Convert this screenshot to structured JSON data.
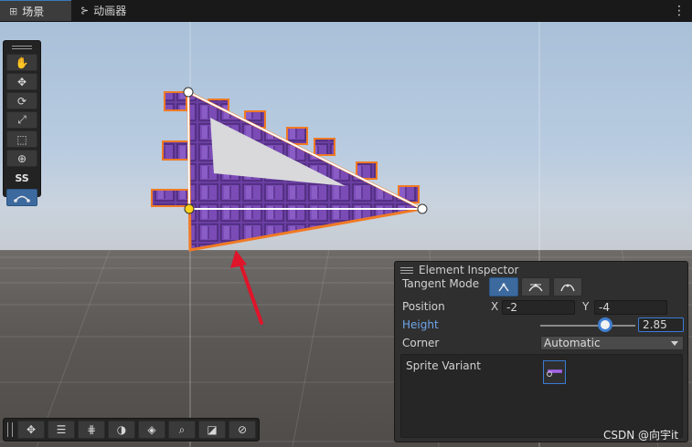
{
  "tabs": [
    {
      "icon": "grid-icon",
      "label": "场景",
      "active": true
    },
    {
      "icon": "animator-icon",
      "label": "动画器",
      "active": false
    }
  ],
  "tabbar_menu": "⋮",
  "left_toolbar": {
    "buttons": [
      {
        "name": "hand-tool",
        "icon": "hand-icon",
        "glyph": "✋"
      },
      {
        "name": "move-tool",
        "icon": "move-icon",
        "glyph": "✥"
      },
      {
        "name": "rotate-tool",
        "icon": "rotate-icon",
        "glyph": "⟳"
      },
      {
        "name": "scale-tool",
        "icon": "scale-icon",
        "glyph": "⤢"
      },
      {
        "name": "rect-tool",
        "icon": "rect-icon",
        "glyph": "⬚"
      },
      {
        "name": "transform-tool",
        "icon": "transform-icon",
        "glyph": "⊕"
      }
    ],
    "text_button": "SS",
    "spline_tool": {
      "icon": "spline-edit-icon",
      "selected": true
    }
  },
  "bottom_toolbar": [
    {
      "name": "move-snap",
      "icon": "move-icon",
      "glyph": "✥"
    },
    {
      "name": "align",
      "icon": "align-icon",
      "glyph": "☰"
    },
    {
      "name": "grid-snap",
      "icon": "grid-snap-icon",
      "glyph": "⋕"
    },
    {
      "name": "sphere-view",
      "icon": "sphere-icon",
      "glyph": "◑"
    },
    {
      "name": "layers",
      "icon": "layers-icon",
      "glyph": "◈"
    },
    {
      "name": "search",
      "icon": "search-icon",
      "glyph": "⌕"
    },
    {
      "name": "camera",
      "icon": "camera-icon",
      "glyph": "◪"
    },
    {
      "name": "navigate",
      "icon": "compass-icon",
      "glyph": "⊘"
    }
  ],
  "inspector": {
    "title": "Element Inspector",
    "tangent_mode": {
      "label": "Tangent Mode",
      "options": [
        {
          "icon": "tangent-linear-icon",
          "selected": true
        },
        {
          "icon": "tangent-continuous-icon",
          "selected": false
        },
        {
          "icon": "tangent-broken-icon",
          "selected": false
        }
      ]
    },
    "position": {
      "label": "Position",
      "x_label": "X",
      "x_value": "-2",
      "y_label": "Y",
      "y_value": "-4"
    },
    "height": {
      "label": "Height",
      "value": "2.85",
      "slider_fraction": 0.68
    },
    "corner": {
      "label": "Corner",
      "value": "Automatic"
    },
    "sprite_variant": {
      "label": "Sprite Variant",
      "thumb_icon": "sprite-thumbnail-icon"
    }
  },
  "watermark": "CSDN @向宇it",
  "colors": {
    "sky_top": "#a9c0d8",
    "ground": "#5c5956",
    "shape_purple": "#6b3fa3",
    "outline_orange": "#f07a24",
    "arrow_red": "#e0142a",
    "selection_blue": "#3d6a9e"
  }
}
